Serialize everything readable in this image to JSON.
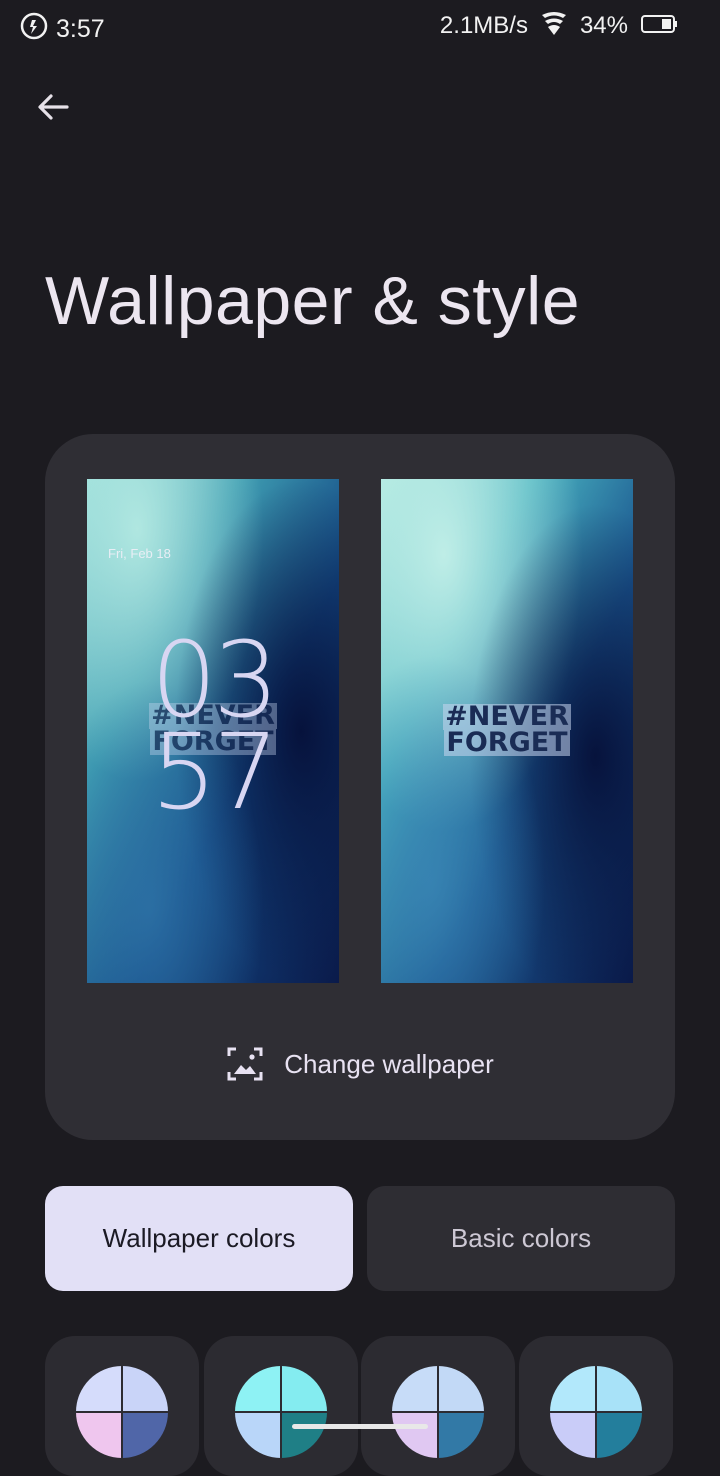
{
  "status_bar": {
    "time": "3:57",
    "network_speed": "2.1MB/s",
    "battery": "34%",
    "icons": [
      "alarm-icon",
      "wifi-icon",
      "battery-icon"
    ]
  },
  "header": {
    "back_icon": "back-arrow-icon",
    "title": "Wallpaper & style"
  },
  "preview": {
    "lock_screen": {
      "date": "Fri, Feb 18",
      "clock_hours": "03",
      "clock_minutes": "57",
      "watermark_line1": "#NEVER",
      "watermark_line2": "FORGET"
    },
    "home_screen": {
      "watermark_line1": "#NEVER",
      "watermark_line2": "FORGET"
    },
    "change_wallpaper_label": "Change wallpaper",
    "change_wallpaper_icon": "image-icon"
  },
  "color_tabs": {
    "wallpaper_colors": "Wallpaper colors",
    "basic_colors": "Basic colors",
    "selected": "Wallpaper colors"
  },
  "swatches": [
    {
      "colors": [
        "#d5dcfb",
        "#c9d4f8",
        "#efc6ee",
        "#5066a8"
      ]
    },
    {
      "colors": [
        "#8ef2f4",
        "#84ecf0",
        "#b9d6f9",
        "#1f7f86"
      ]
    },
    {
      "colors": [
        "#c7dcf8",
        "#c2d9f6",
        "#e0c8f2",
        "#3279a6"
      ]
    },
    {
      "colors": [
        "#b2e8fb",
        "#a8e2f8",
        "#c9ccf8",
        "#237e9c"
      ]
    }
  ],
  "colors": {
    "background": "#1c1b20",
    "card": "#2f2e34",
    "selected_tab": "#e2e0f6",
    "unselected_tab": "#2e2d33"
  }
}
